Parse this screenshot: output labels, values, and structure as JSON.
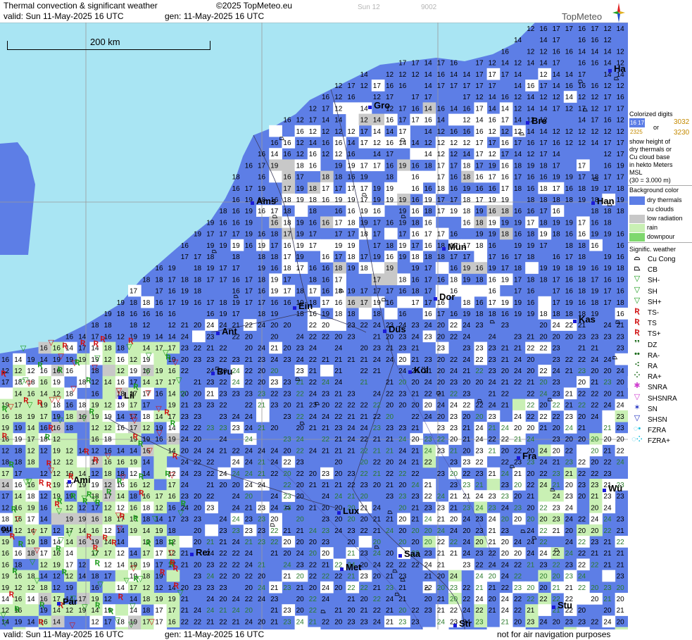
{
  "header": {
    "title": "Thermal convection & significant weather",
    "copyright": "©2025 TopMeteo.eu",
    "faint_code_1": "Sun 12",
    "faint_code_2": "9002",
    "valid": "valid:  Sun  11-May-2025  16 UTC",
    "gen": "gen: 11-May-2025 16 UTC",
    "logo_text": "TopMeteo"
  },
  "footer": {
    "valid": "valid:  Sun  11-May-2025  16 UTC",
    "gen": "gen: 11-May-2025 16 UTC",
    "disclaimer": "not for air navigation purposes"
  },
  "map": {
    "scale_label": "200 km",
    "cities": [
      {
        "name": "Ha"
      },
      {
        "name": "Gro"
      },
      {
        "name": "Bre"
      },
      {
        "name": "Ams"
      },
      {
        "name": "Han"
      },
      {
        "name": "Mün"
      },
      {
        "name": "Dor"
      },
      {
        "name": "Ein"
      },
      {
        "name": "Kas"
      },
      {
        "name": "Ant"
      },
      {
        "name": "Düs"
      },
      {
        "name": "Bru"
      },
      {
        "name": "Köl"
      },
      {
        "name": "Lil"
      },
      {
        "name": "Fra"
      },
      {
        "name": "Ami"
      },
      {
        "name": "Wü"
      },
      {
        "name": "Lux"
      },
      {
        "name": "Rei"
      },
      {
        "name": "Saa"
      },
      {
        "name": "Met"
      },
      {
        "name": "Par"
      },
      {
        "name": "Stu"
      },
      {
        "name": "Str"
      },
      {
        "name": "ou"
      }
    ],
    "sample_numbers": [
      "12",
      "14",
      "16",
      "17",
      "18",
      "19",
      "20",
      "21",
      "22",
      "23",
      "24",
      "25"
    ]
  },
  "legend": {
    "digits_title": "Colorized digits",
    "digits_example_1": "16 17",
    "digits_example_2": "2325",
    "digits_or": "or",
    "digits_cu_1": "3032",
    "digits_cu_2": "3230",
    "digits_text": [
      "show height of",
      "dry thermals or",
      "Cu cloud base",
      "in hekto Meters",
      "MSL",
      "(30 = 3.000 m)"
    ],
    "background_title": "Background color",
    "background_items": [
      {
        "label": "dry thermals",
        "color": "#5d7ee6"
      },
      {
        "label": "cu clouds",
        "color": "#ffffff"
      },
      {
        "label": "low radiation",
        "color": "#c8c8c8"
      },
      {
        "label": "rain",
        "color": "#c9f0b4"
      },
      {
        "label": "downpour",
        "color": "#7fd86e"
      }
    ],
    "weather_title": "Signific. weather",
    "weather_items": [
      {
        "label": "Cu Cong",
        "icon": "cu-cong-icon",
        "glyph": "⌓",
        "color": "#000000"
      },
      {
        "label": "CB",
        "icon": "cb-icon",
        "glyph": "⏢",
        "color": "#000000"
      },
      {
        "label": "SH-",
        "icon": "shower-light-icon",
        "glyph": "▽",
        "color": "#1a9a1a"
      },
      {
        "label": "SH",
        "icon": "shower-icon",
        "glyph": "▽",
        "color": "#1a9a1a"
      },
      {
        "label": "SH+",
        "icon": "shower-heavy-icon",
        "glyph": "▽",
        "color": "#1a9a1a"
      },
      {
        "label": "TS-",
        "icon": "thunderstorm-light-icon",
        "glyph": "Ʀ",
        "color": "#d01010"
      },
      {
        "label": "TS",
        "icon": "thunderstorm-icon",
        "glyph": "Ʀ",
        "color": "#d01010"
      },
      {
        "label": "TS+",
        "icon": "thunderstorm-heavy-icon",
        "glyph": "Ʀ",
        "color": "#d01010"
      },
      {
        "label": "DZ",
        "icon": "drizzle-icon",
        "glyph": "❜❜",
        "color": "#1a6a1a"
      },
      {
        "label": "RA-",
        "icon": "rain-light-icon",
        "glyph": "••",
        "color": "#1a6a1a"
      },
      {
        "label": "RA",
        "icon": "rain-icon",
        "glyph": "⁖",
        "color": "#1a6a1a"
      },
      {
        "label": "RA+",
        "icon": "rain-heavy-icon",
        "glyph": "⁘",
        "color": "#1a6a1a"
      },
      {
        "label": "SNRA",
        "icon": "snow-rain-icon",
        "glyph": "✱",
        "color": "#d040d0"
      },
      {
        "label": "SHSNRA",
        "icon": "shower-snow-rain-icon",
        "glyph": "▽",
        "color": "#d040d0"
      },
      {
        "label": "SN",
        "icon": "snow-icon",
        "glyph": "✶",
        "color": "#2030c0"
      },
      {
        "label": "SHSN",
        "icon": "shower-snow-icon",
        "glyph": "▽",
        "color": "#2030c0"
      },
      {
        "label": "FZRA",
        "icon": "freezing-rain-icon",
        "glyph": "◌•",
        "color": "#20c0e0"
      },
      {
        "label": "FZRA+",
        "icon": "freezing-rain-heavy-icon",
        "glyph": "◌⁘",
        "color": "#20c0e0"
      }
    ]
  }
}
